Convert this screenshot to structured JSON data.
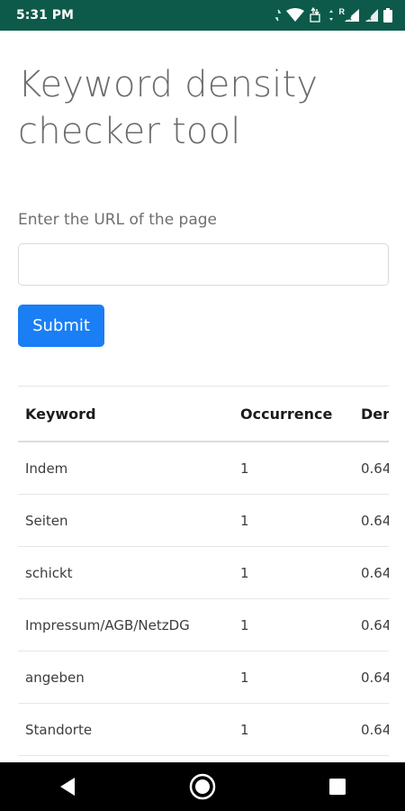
{
  "status_bar": {
    "time": "5:31 PM",
    "icons": [
      "vibrate-icon",
      "wifi-icon",
      "data-transfer-icon",
      "signal-icon",
      "roaming-signal-icon",
      "signal-icon-2",
      "battery-icon"
    ],
    "roaming_indicator": "R"
  },
  "page": {
    "title": "Keyword density checker tool",
    "url_label": "Enter the URL of the page",
    "url_input_value": "",
    "url_input_placeholder": "",
    "submit_label": "Submit"
  },
  "table": {
    "headers": [
      "Keyword",
      "Occurrence",
      "Dens"
    ],
    "rows": [
      [
        "Indem",
        "1",
        "0.64"
      ],
      [
        "Seiten",
        "1",
        "0.64"
      ],
      [
        "schickt",
        "1",
        "0.64"
      ],
      [
        "Impressum/AGB/NetzDG",
        "1",
        "0.64"
      ],
      [
        "angeben",
        "1",
        "0.64"
      ],
      [
        "Standorte",
        "1",
        "0.64"
      ]
    ]
  },
  "nav_bar": {
    "buttons": [
      "back-icon",
      "home-icon",
      "recents-icon"
    ]
  },
  "colors": {
    "status_bar": "#0d5a4a",
    "accent": "#1a7ef5",
    "nav_bar": "#000000"
  }
}
